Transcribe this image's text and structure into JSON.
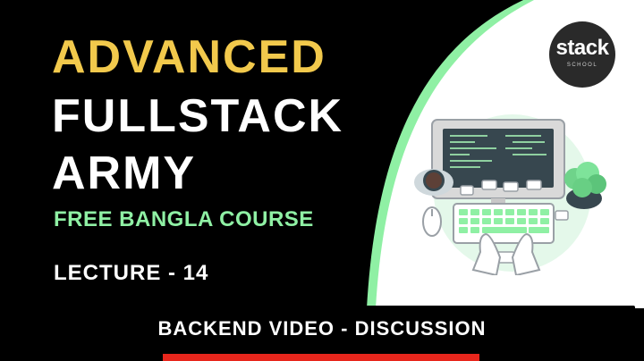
{
  "title": {
    "line1": "ADVANCED",
    "line2": "FULLSTACK",
    "line3": "ARMY"
  },
  "subtitle": "FREE BANGLA COURSE",
  "lecture": "LECTURE - 14",
  "banner": "BACKEND VIDEO - DISCUSSION",
  "logo": {
    "main": "stack",
    "sub": "SCHOOL"
  },
  "illustration": {
    "icon": "laptop-coding-illustration"
  },
  "colors": {
    "background": "#000000",
    "panel": "#ffffff",
    "accent_yellow": "#f2c94c",
    "accent_green": "#8ff0a4",
    "banner_bar": "#e8261c"
  }
}
